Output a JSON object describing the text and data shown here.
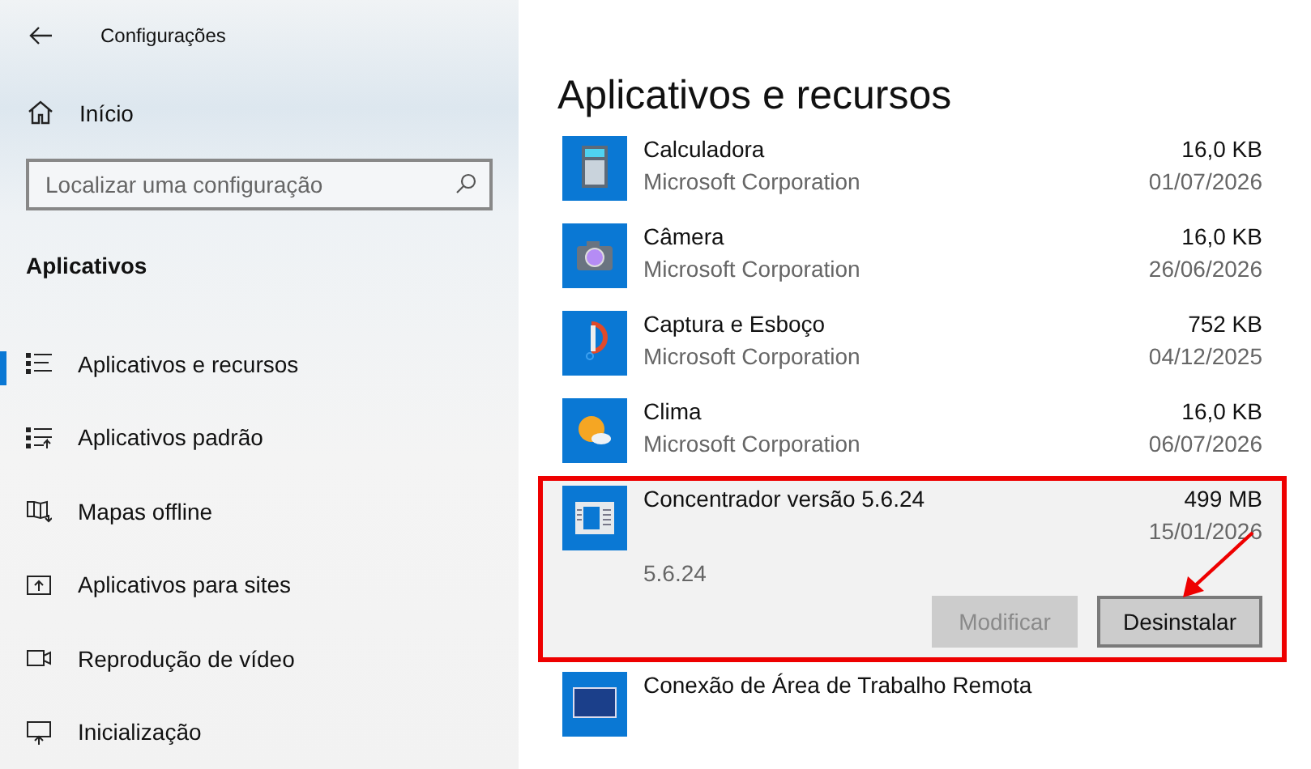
{
  "window": {
    "title": "Configurações"
  },
  "sidebar": {
    "home": "Início",
    "search": {
      "placeholder": "Localizar uma configuração"
    },
    "section": "Aplicativos",
    "items": [
      {
        "label": "Aplicativos e recursos",
        "selected": true
      },
      {
        "label": "Aplicativos padrão",
        "selected": false
      },
      {
        "label": "Mapas offline",
        "selected": false
      },
      {
        "label": "Aplicativos para sites",
        "selected": false
      },
      {
        "label": "Reprodução de vídeo",
        "selected": false
      },
      {
        "label": "Inicialização",
        "selected": false
      }
    ]
  },
  "main": {
    "title": "Aplicativos e recursos",
    "apps": [
      {
        "name": "Calculadora",
        "publisher": "Microsoft Corporation",
        "size": "16,0 KB",
        "date": "01/07/2026",
        "selected": false
      },
      {
        "name": "Câmera",
        "publisher": "Microsoft Corporation",
        "size": "16,0 KB",
        "date": "26/06/2026",
        "selected": false
      },
      {
        "name": "Captura e Esboço",
        "publisher": "Microsoft Corporation",
        "size": "752 KB",
        "date": "04/12/2025",
        "selected": false
      },
      {
        "name": "Clima",
        "publisher": "Microsoft Corporation",
        "size": "16,0 KB",
        "date": "06/07/2026",
        "selected": false
      },
      {
        "name": "Concentrador versão 5.6.24",
        "size": "499 MB",
        "date": "15/01/2026",
        "version": "5.6.24",
        "selected": true,
        "buttons": [
          {
            "label": "Modificar",
            "disabled": true
          },
          {
            "label": "Desinstalar",
            "disabled": false
          }
        ]
      },
      {
        "name": "Conexão de Área de Trabalho Remota",
        "selected": false
      }
    ]
  }
}
